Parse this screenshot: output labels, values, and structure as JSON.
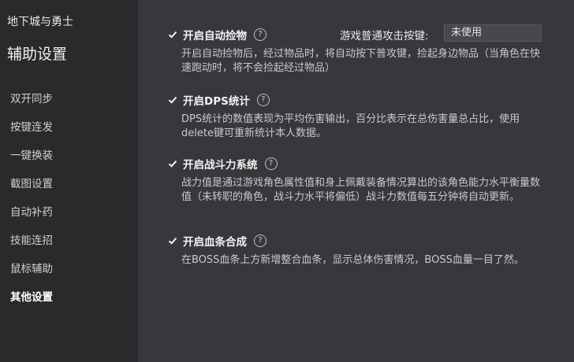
{
  "app": {
    "title": "地下城与勇士"
  },
  "sidebar": {
    "section_title": "辅助设置",
    "items": [
      {
        "label": "双开同步"
      },
      {
        "label": "按键连发"
      },
      {
        "label": "一键换装"
      },
      {
        "label": "截图设置"
      },
      {
        "label": "自动补药"
      },
      {
        "label": "技能连招"
      },
      {
        "label": "鼠标辅助"
      },
      {
        "label": "其他设置",
        "active": true
      }
    ]
  },
  "settings": {
    "auto_pickup": {
      "label": "开启自动捡物",
      "checked": true,
      "help": "?",
      "attack_key_label": "游戏普通攻击按键:",
      "attack_key_value": "未使用",
      "desc": "开启自动捡物后，经过物品时，将自动按下普攻键，捡起身边物品（当角色在快速跑动时，将不会捡起经过物品）"
    },
    "dps": {
      "label": "开启DPS统计",
      "checked": true,
      "help": "?",
      "desc": "DPS统计的数值表现为平均伤害输出，百分比表示在总伤害量总占比，使用delete键可重新统计本人数据。"
    },
    "power": {
      "label": "开启战斗力系统",
      "checked": true,
      "help": "?",
      "desc": "战力值是通过游戏角色属性值和身上佩戴装备情况算出的该角色能力水平衡量数值（未转职的角色，战斗力水平将偏低）战斗力数值每五分钟将自动更新。"
    },
    "hp_bar": {
      "label": "开启血条合成",
      "checked": true,
      "help": "?",
      "desc": "在BOSS血条上方新增整合血条，显示总体伤害情况，BOSS血量一目了然。"
    }
  },
  "colors": {
    "accent": "#ffffff",
    "sidebar_bg": "#2a2a2d",
    "main_bg": "#38383c"
  }
}
